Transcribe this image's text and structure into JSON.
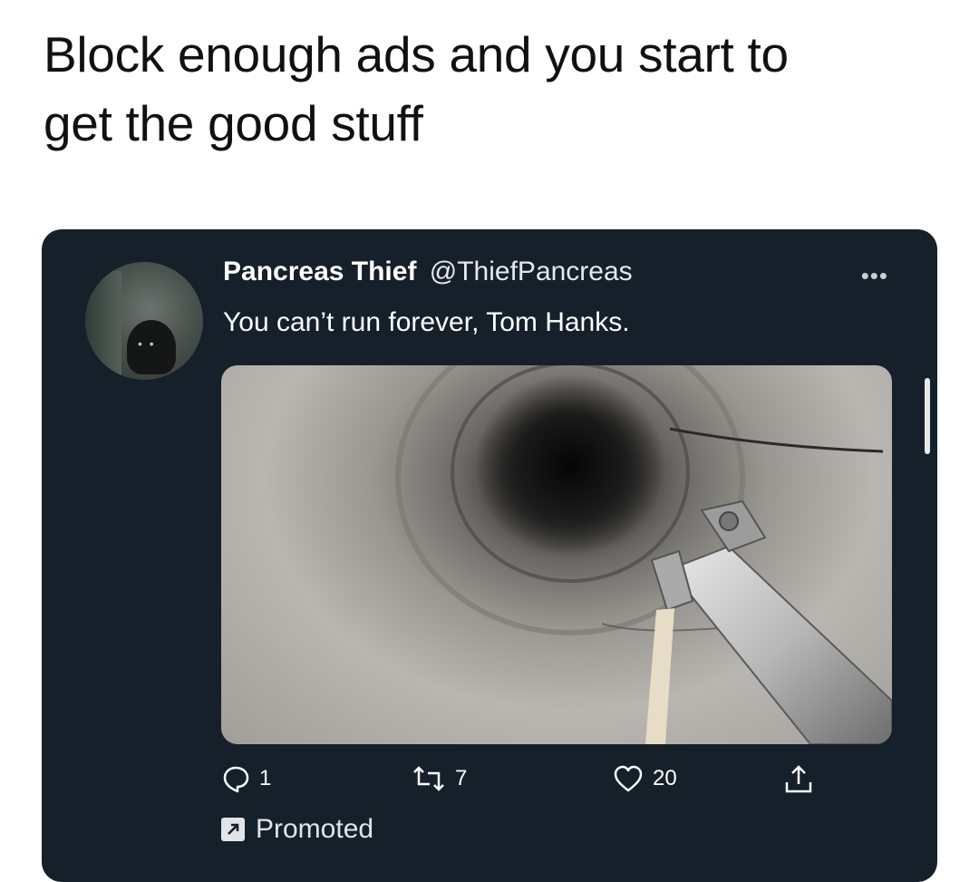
{
  "caption": {
    "line1": "Block enough ads and you start to",
    "line2": "get the good stuff"
  },
  "tweet": {
    "display_name": "Pancreas Thief",
    "handle": "@ThiefPancreas",
    "text": "You can’t run forever, Tom Hanks.",
    "more_icon": "ellipsis-icon",
    "media_description_icon": "tunnel-image",
    "actions": {
      "reply_count": "1",
      "retweet_count": "7",
      "like_count": "20",
      "reply_icon": "reply-icon",
      "retweet_icon": "retweet-icon",
      "like_icon": "heart-icon",
      "share_icon": "share-icon"
    },
    "promoted_label": "Promoted",
    "promoted_icon": "promoted-arrow-icon"
  },
  "colors": {
    "card_bg": "#15202b",
    "caption_text": "#111111",
    "tweet_text": "#ffffff"
  }
}
